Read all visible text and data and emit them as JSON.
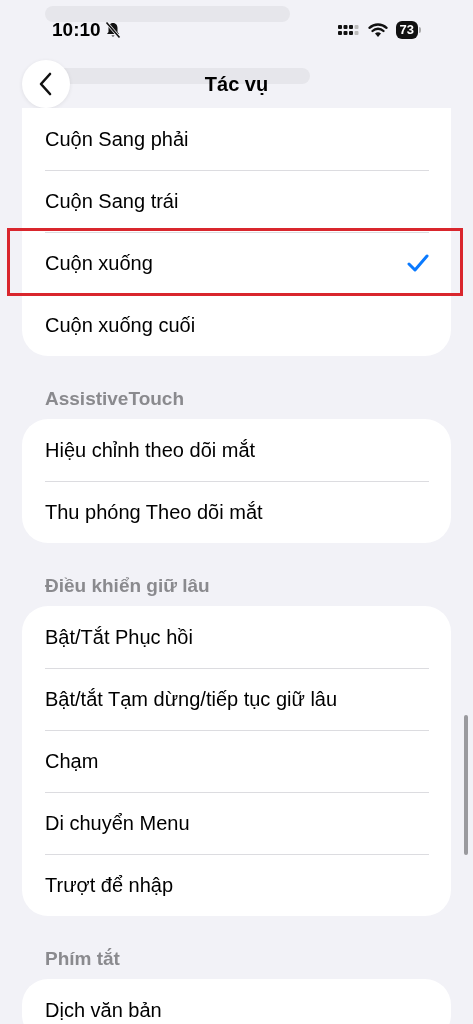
{
  "status_bar": {
    "time": "10:10",
    "battery": "73"
  },
  "nav": {
    "title": "Tác vụ"
  },
  "sections": [
    {
      "items": [
        {
          "label": "Cuộn Sang phải",
          "selected": false,
          "annotated": false
        },
        {
          "label": "Cuộn Sang trái",
          "selected": false,
          "annotated": false
        },
        {
          "label": "Cuộn xuống",
          "selected": true,
          "annotated": true
        },
        {
          "label": "Cuộn xuống cuối",
          "selected": false,
          "annotated": false
        }
      ]
    },
    {
      "header": "AssistiveTouch",
      "items": [
        {
          "label": "Hiệu chỉnh theo dõi mắt",
          "selected": false,
          "annotated": false
        },
        {
          "label": "Thu phóng Theo dõi mắt",
          "selected": false,
          "annotated": false
        }
      ]
    },
    {
      "header": "Điều khiển giữ lâu",
      "items": [
        {
          "label": "Bật/Tắt Phục hồi",
          "selected": false,
          "annotated": false
        },
        {
          "label": "Bật/tắt Tạm dừng/tiếp tục giữ lâu",
          "selected": false,
          "annotated": false
        },
        {
          "label": "Chạm",
          "selected": false,
          "annotated": false
        },
        {
          "label": "Di chuyển Menu",
          "selected": false,
          "annotated": false
        },
        {
          "label": "Trượt để nhập",
          "selected": false,
          "annotated": false
        }
      ]
    },
    {
      "header": "Phím tắt",
      "items": [
        {
          "label": "Dịch văn bản",
          "selected": false,
          "annotated": false
        }
      ]
    }
  ]
}
